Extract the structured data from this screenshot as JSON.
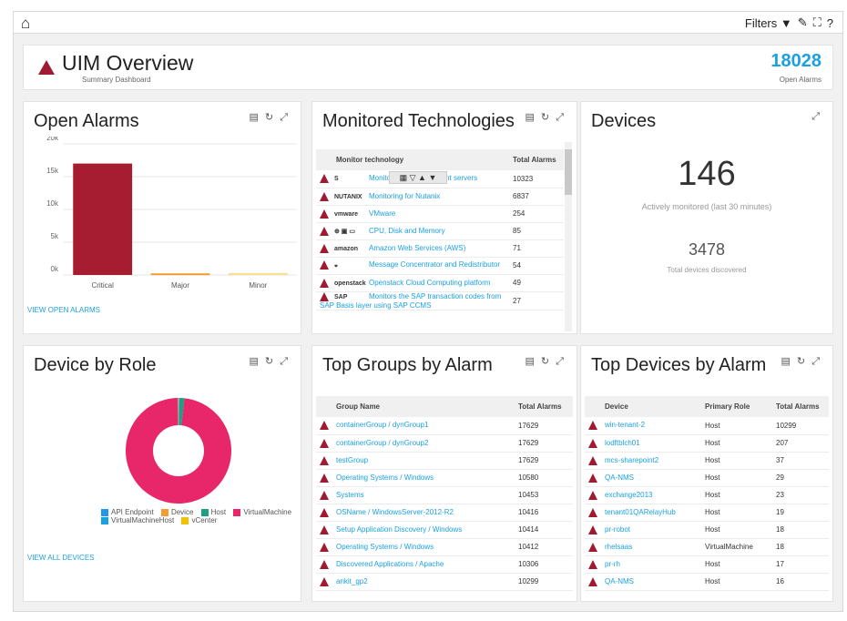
{
  "toolbar": {
    "filters_label": "Filters"
  },
  "header": {
    "title": "UIM Overview",
    "subtitle": "Summary Dashboard",
    "open_alarms_count": "18028",
    "open_alarms_label": "Open Alarms"
  },
  "open_alarms": {
    "title": "Open Alarms",
    "link": "VIEW OPEN ALARMS",
    "chart_data": {
      "type": "bar",
      "categories": [
        "Critical",
        "Major",
        "Minor"
      ],
      "values": [
        17000,
        250,
        300
      ],
      "colors": [
        "#a61c30",
        "#f39c33",
        "#f7e08e"
      ],
      "ylim": [
        0,
        20000
      ],
      "yticks": [
        "0k",
        "5k",
        "10k",
        "15k",
        "20k"
      ],
      "title": "",
      "xlabel": "",
      "ylabel": ""
    }
  },
  "monitored": {
    "title": "Monitored Technologies",
    "col1": "Monitor technology",
    "col2": "Total Alarms",
    "rows": [
      {
        "logo": "S",
        "name": "Monitoring for SharePoint servers",
        "total": "10323"
      },
      {
        "logo": "NUTANIX",
        "name": "Monitoring for Nutanix",
        "total": "6837"
      },
      {
        "logo": "vmware",
        "name": "VMware",
        "total": "254"
      },
      {
        "logo": "⊕ ▣ ▭",
        "name": "CPU, Disk and Memory",
        "total": "85"
      },
      {
        "logo": "amazon",
        "name": "Amazon Web Services (AWS)",
        "total": "71"
      },
      {
        "logo": "⌖",
        "name": "Message Concentrator and Redistributor",
        "total": "54"
      },
      {
        "logo": "openstack",
        "name": "Openstack Cloud Computing platform",
        "total": "49"
      },
      {
        "logo": "SAP",
        "name": "Monitors the SAP transaction codes from SAP Basis layer using SAP CCMS",
        "total": "27"
      }
    ]
  },
  "devices": {
    "title": "Devices",
    "monitored": "146",
    "monitored_label": "Actively monitored (last 30 minutes)",
    "discovered": "3478",
    "discovered_label": "Total devices discovered"
  },
  "device_role": {
    "title": "Device by Role",
    "link": "VIEW ALL DEVICES",
    "chart_data": {
      "type": "pie",
      "categories": [
        "API Endpoint",
        "Device",
        "Host",
        "VirtualMachine",
        "VirtualMachineHost",
        "vCenter"
      ],
      "values": [
        0.2,
        0.1,
        1.5,
        98.0,
        0.1,
        0.1
      ],
      "colors": [
        "#2196f3",
        "#f39c33",
        "#1e9e82",
        "#e8266a",
        "#1ba1e2",
        "#f2c200"
      ]
    }
  },
  "top_groups": {
    "title": "Top Groups by Alarm",
    "col1": "Group Name",
    "col2": "Total Alarms",
    "rows": [
      {
        "name": "containerGroup / dynGroup1",
        "total": "17629"
      },
      {
        "name": "containerGroup / dynGroup2",
        "total": "17629"
      },
      {
        "name": "testGroup",
        "total": "17629"
      },
      {
        "name": "Operating Systems / Windows",
        "total": "10580"
      },
      {
        "name": "Systems",
        "total": "10453"
      },
      {
        "name": "OSName / WindowsServer-2012-R2",
        "total": "10416"
      },
      {
        "name": "Setup Application Discovery / Windows",
        "total": "10414"
      },
      {
        "name": "Operating Systems / Windows",
        "total": "10412"
      },
      {
        "name": "Discovered Applications / Apache",
        "total": "10306"
      },
      {
        "name": "ankit_gp2",
        "total": "10299"
      }
    ]
  },
  "top_devices": {
    "title": "Top Devices by Alarm",
    "col1": "Device",
    "col2": "Primary Role",
    "col3": "Total Alarms",
    "rows": [
      {
        "name": "win-tenant-2",
        "role": "Host",
        "total": "10299"
      },
      {
        "name": "lodftblch01",
        "role": "Host",
        "total": "207"
      },
      {
        "name": "mcs-sharepoint2",
        "role": "Host",
        "total": "37"
      },
      {
        "name": "QA-NMS",
        "role": "Host",
        "total": "29"
      },
      {
        "name": "exchange2013",
        "role": "Host",
        "total": "23"
      },
      {
        "name": "tenant01QARelayHub",
        "role": "Host",
        "total": "19"
      },
      {
        "name": "pr-robot",
        "role": "Host",
        "total": "18"
      },
      {
        "name": "rhelsaas",
        "role": "VirtualMachine",
        "total": "18"
      },
      {
        "name": "pr-rh",
        "role": "Host",
        "total": "17"
      },
      {
        "name": "QA-NMS",
        "role": "Host",
        "total": "16"
      }
    ]
  }
}
